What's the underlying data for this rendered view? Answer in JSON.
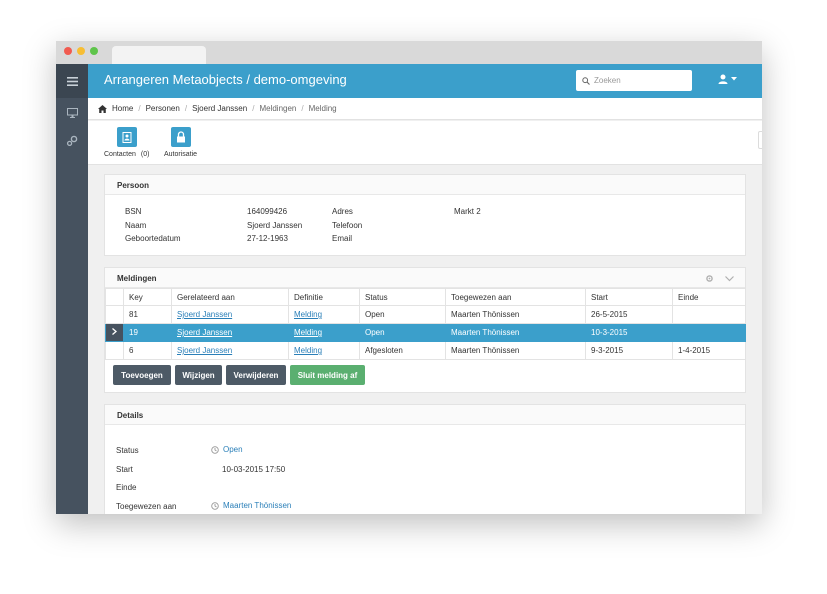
{
  "app": {
    "title": "Arrangeren Metaobjects / demo-omgeving"
  },
  "search": {
    "placeholder": "Zoeken"
  },
  "breadcrumb": [
    "Home",
    "Personen",
    "Sjoerd Janssen",
    "Meldingen",
    "Melding"
  ],
  "toolbar": {
    "contacts_label": "Contacten",
    "contacts_count": "(0)",
    "auth_label": "Autorisatie",
    "more_label": "⋮"
  },
  "person": {
    "title": "Persoon",
    "bsn_label": "BSN",
    "bsn_value": "164099426",
    "naam_label": "Naam",
    "naam_value": "Sjoerd Janssen",
    "geb_label": "Geboortedatum",
    "geb_value": "27-12-1963",
    "adres_label": "Adres",
    "adres_value": "Markt 2",
    "telefoon_label": "Telefoon",
    "email_label": "Email"
  },
  "meldingen": {
    "title": "Meldingen",
    "columns": [
      "Key",
      "Gerelateerd aan",
      "Definitie",
      "Status",
      "Toegewezen aan",
      "Start",
      "Einde"
    ],
    "rows": [
      [
        "81",
        "Sjoerd Janssen",
        "Melding",
        "Open",
        "Maarten Thönissen",
        "26-5-2015",
        ""
      ],
      [
        "19",
        "Sjoerd Janssen",
        "Melding",
        "Open",
        "Maarten Thönissen",
        "10-3-2015",
        ""
      ],
      [
        "6",
        "Sjoerd Janssen",
        "Melding",
        "Afgesloten",
        "Maarten Thönissen",
        "9-3-2015",
        "1-4-2015"
      ]
    ],
    "selected_row": 1,
    "buttons": {
      "add": "Toevoegen",
      "edit": "Wijzigen",
      "delete": "Verwijderen",
      "close": "Sluit melding af"
    }
  },
  "details": {
    "title": "Details",
    "status_label": "Status",
    "status_value": "Open",
    "start_label": "Start",
    "start_value": "10-03-2015 17:50",
    "einde_label": "Einde",
    "assigned_label": "Toegewezen aan",
    "assigned_value": "Maarten Thönissen"
  },
  "colors": {
    "accent": "#3b9fcb",
    "sidebar": "#46525f",
    "button_dark": "#4d5a66",
    "button_green": "#5aaf70",
    "link": "#2a7fb8"
  },
  "icons": [
    "hamburger-icon",
    "monitor-icon",
    "gears-icon",
    "search-icon",
    "user-icon",
    "home-icon",
    "contacts-icon",
    "lock-icon",
    "settings-icon",
    "chevron-down-icon",
    "clock-icon",
    "chevron-right-icon"
  ]
}
